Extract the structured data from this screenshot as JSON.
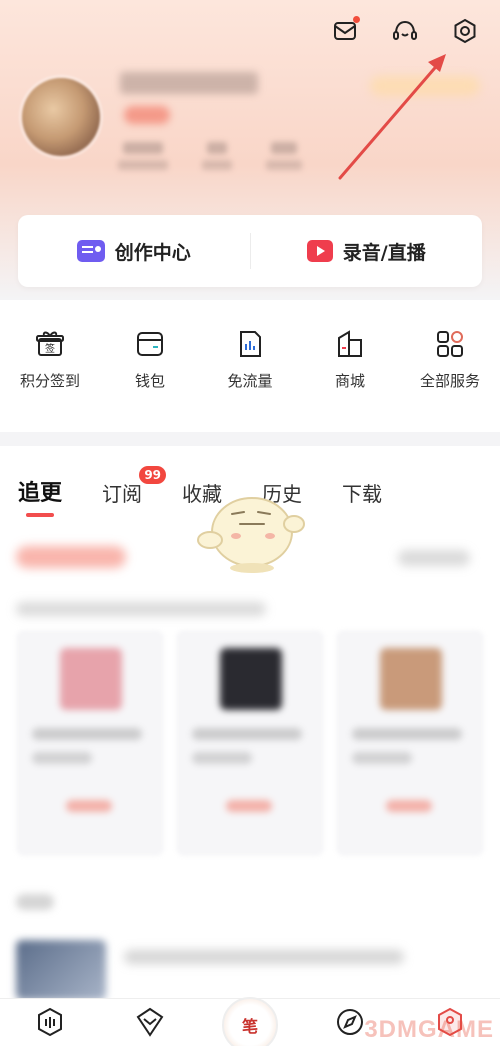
{
  "colors": {
    "accent": "#f24d3b",
    "arrow": "#e34b47",
    "create_icon": "#6f5cf0",
    "record_icon": "#ef3d4d"
  },
  "top_icons": [
    "mail-icon",
    "customer-service-icon",
    "settings-icon"
  ],
  "create_bar": {
    "create_label": "创作中心",
    "record_label": "录音/直播"
  },
  "services": [
    {
      "label": "积分签到",
      "icon": "sign-in-gift-icon",
      "glyph": "签"
    },
    {
      "label": "钱包",
      "icon": "wallet-icon"
    },
    {
      "label": "免流量",
      "icon": "free-data-icon"
    },
    {
      "label": "商城",
      "icon": "shop-icon"
    },
    {
      "label": "全部服务",
      "icon": "all-services-icon"
    }
  ],
  "tabs": [
    {
      "label": "追更",
      "active": true
    },
    {
      "label": "订阅",
      "badge": "99"
    },
    {
      "label": "收藏"
    },
    {
      "label": "历史"
    },
    {
      "label": "下载"
    }
  ],
  "bottom_nav": [
    {
      "icon": "home-icon"
    },
    {
      "icon": "vip-icon"
    },
    {
      "icon": "center-logo",
      "text": "笔"
    },
    {
      "icon": "discover-icon"
    },
    {
      "icon": "mine-icon"
    }
  ],
  "watermark": "3DMGAME"
}
